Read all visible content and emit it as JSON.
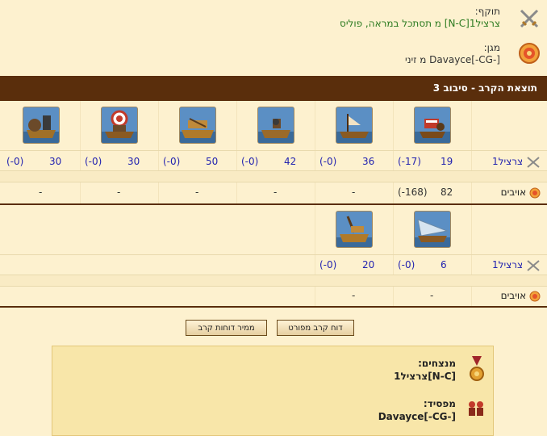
{
  "attacker": {
    "label": "תוקף:",
    "name": "צרציל1[N-C] מ תסתכל במראה, פוליס"
  },
  "defender": {
    "label": "מגן:",
    "name": "Davayce[-CG-] מ זיני"
  },
  "round_title": "תוצאת הקרב - סיבוב 3",
  "units_top": [
    {
      "icon": "fire-ship-icon"
    },
    {
      "icon": "paddle-steamer-icon"
    },
    {
      "icon": "ram-ship-icon"
    },
    {
      "icon": "catapult-ship-icon"
    },
    {
      "icon": "mortar-ship-icon"
    },
    {
      "icon": "steam-ram-icon"
    }
  ],
  "attacker_row_label": "צרציל1",
  "attacker_top": [
    {
      "count": "19",
      "loss": "(-17)"
    },
    {
      "count": "36",
      "loss": "(-0)"
    },
    {
      "count": "42",
      "loss": "(-0)"
    },
    {
      "count": "50",
      "loss": "(-0)"
    },
    {
      "count": "30",
      "loss": "(-0)"
    },
    {
      "count": "30",
      "loss": "(-0)"
    }
  ],
  "enemy_row_label": "אויבים",
  "enemy_top": [
    {
      "count": "82",
      "loss": "(-168)"
    },
    {
      "count": "-",
      "loss": ""
    },
    {
      "count": "-",
      "loss": ""
    },
    {
      "count": "-",
      "loss": ""
    },
    {
      "count": "-",
      "loss": ""
    },
    {
      "count": "-",
      "loss": ""
    }
  ],
  "units_bottom": [
    {
      "icon": "rocket-ship-icon"
    },
    {
      "icon": "ballista-ship-icon"
    }
  ],
  "attacker_bottom": [
    {
      "count": "6",
      "loss": "(-0)"
    },
    {
      "count": "20",
      "loss": "(-0)"
    }
  ],
  "enemy_bottom": [
    {
      "count": "-"
    },
    {
      "count": "-"
    }
  ],
  "buttons": {
    "detailed": "דוח קרב מפורט",
    "summary": "ממיר דוחות קרב"
  },
  "result": {
    "winners_label": "מנצחים:",
    "winners_value": "צרציל1[N-C]",
    "losers_label": "מפסיד:",
    "losers_value": "Davayce[-CG-]"
  }
}
